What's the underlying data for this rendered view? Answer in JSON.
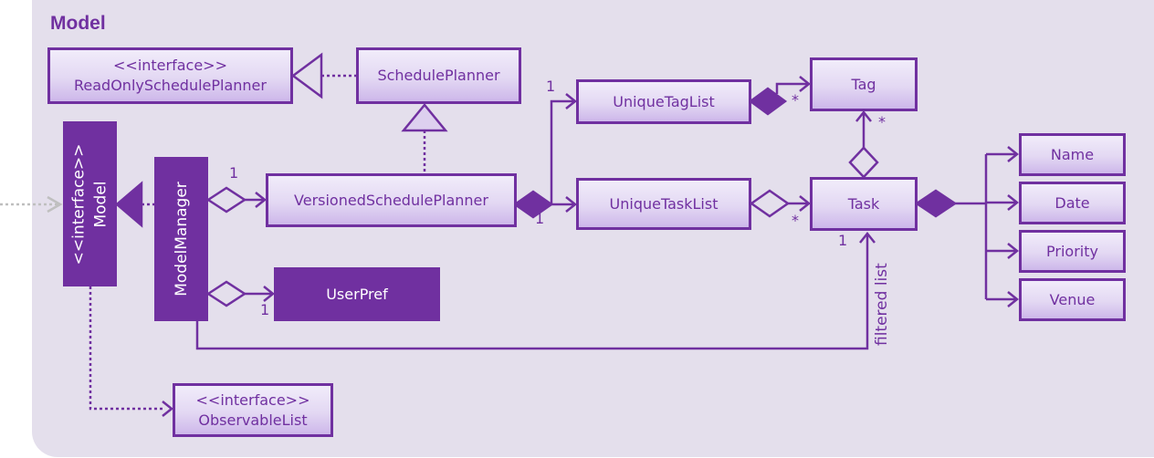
{
  "package": {
    "title": "Model"
  },
  "colors": {
    "accent": "#7030a0",
    "package_bg": "#e4dfec",
    "external_arrow": "#bfbfbf"
  },
  "classes": {
    "read_only": {
      "stereotype": "<<interface>>",
      "name": "ReadOnlySchedulePlanner"
    },
    "schedule_planner": {
      "name": "SchedulePlanner"
    },
    "versioned": {
      "name": "VersionedSchedulePlanner"
    },
    "unique_tag_list": {
      "name": "UniqueTagList"
    },
    "unique_task_list": {
      "name": "UniqueTaskList"
    },
    "tag": {
      "name": "Tag"
    },
    "task": {
      "name": "Task"
    },
    "model": {
      "stereotype": "<<interface>>",
      "name": "Model"
    },
    "model_manager": {
      "name": "ModelManager"
    },
    "user_pref": {
      "name": "UserPref"
    },
    "observable_list": {
      "stereotype": "<<interface>>",
      "name": "ObservableList"
    },
    "attributes": [
      {
        "name": "Name"
      },
      {
        "name": "Date"
      },
      {
        "name": "Priority"
      },
      {
        "name": "Venue"
      }
    ]
  },
  "multiplicities": {
    "sp_to_tag_list": "1",
    "vsp_to_task_list": "1",
    "tag_list_to_tag": "*",
    "task_to_tag": "*",
    "task_list_to_task": "*",
    "filtered_to_task": "1",
    "mm_to_vsp": "1",
    "mm_to_userpref": "1"
  },
  "edge_labels": {
    "filtered_list": "filtered list"
  }
}
